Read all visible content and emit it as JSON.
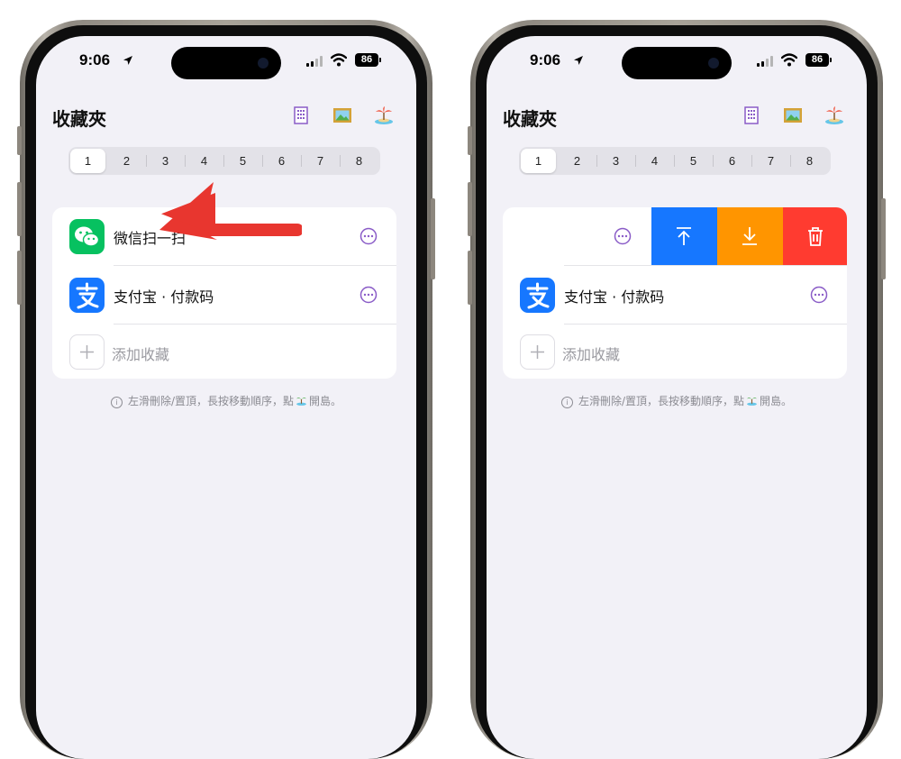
{
  "status": {
    "time": "9:06",
    "battery": "86"
  },
  "header": {
    "title": "收藏夾",
    "icons": [
      "building-icon",
      "picture-frame-icon",
      "island-icon"
    ]
  },
  "pages": {
    "options": [
      "1",
      "2",
      "3",
      "4",
      "5",
      "6",
      "7",
      "8"
    ],
    "selected": "1"
  },
  "favorites": [
    {
      "label": "微信扫一扫",
      "icon": "wechat-icon",
      "color": "#07c160"
    },
    {
      "label": "支付宝 · 付款码",
      "icon": "alipay-icon",
      "color": "#1677ff"
    }
  ],
  "add_label": "添加收藏",
  "hint": "左滑刪除/置頂，長按移動順序，點",
  "hint_tail": "開島。",
  "swipe_actions": [
    {
      "name": "pin-top",
      "color": "#1677ff"
    },
    {
      "name": "move-down",
      "color": "#ff9500"
    },
    {
      "name": "delete",
      "color": "#ff3b30"
    }
  ],
  "left_label_visible": "微信扫一扫"
}
